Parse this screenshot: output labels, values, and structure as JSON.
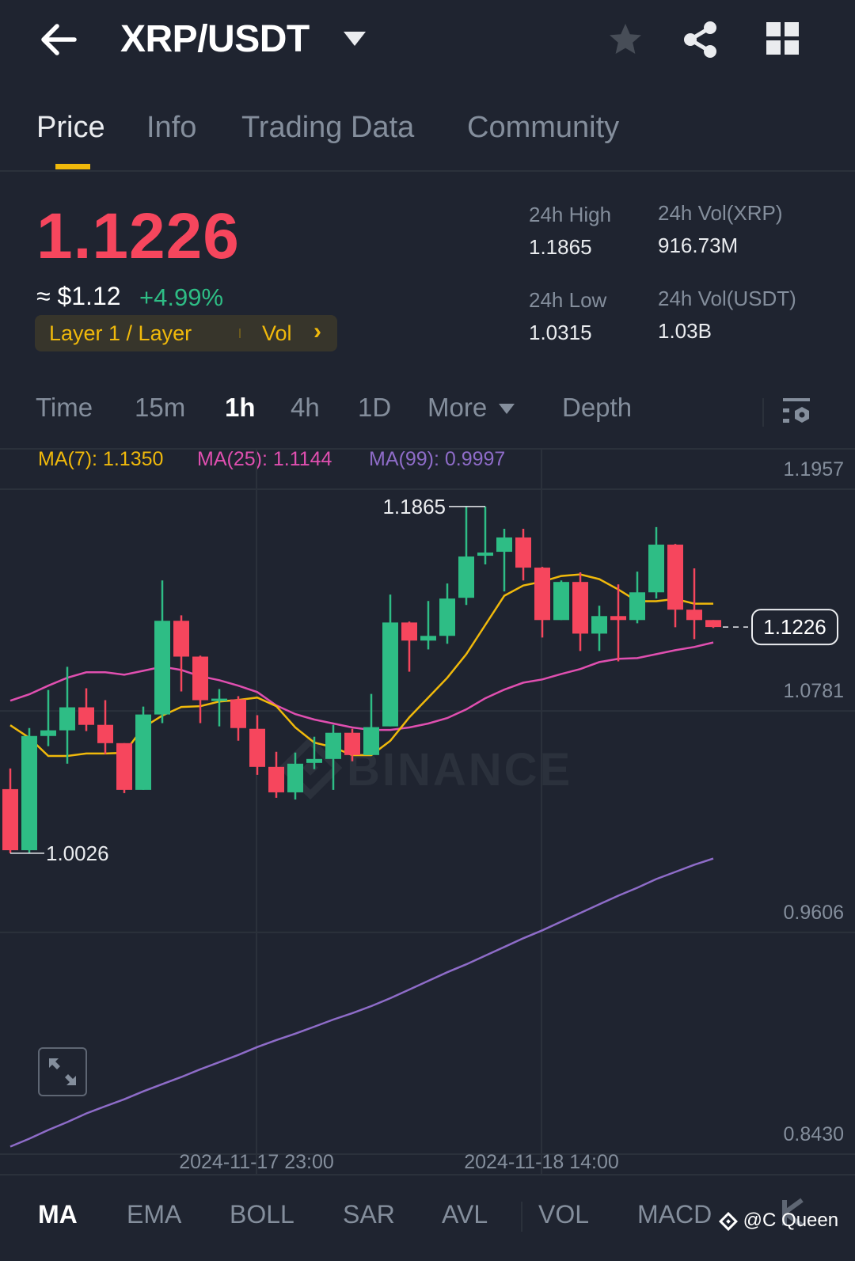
{
  "header": {
    "title": "XRP/USDT",
    "icons": [
      "back-arrow-icon",
      "caret-down-icon",
      "star-icon",
      "share-icon",
      "grid-icon"
    ]
  },
  "tabs": [
    {
      "label": "Price",
      "active": true
    },
    {
      "label": "Info",
      "active": false
    },
    {
      "label": "Trading Data",
      "active": false
    },
    {
      "label": "Community",
      "active": false
    }
  ],
  "ticker": {
    "last_price": "1.1226",
    "fiat_price": "≈ $1.12",
    "change": "+4.99%",
    "tag_label": "Layer 1 / Layer",
    "tag_vol": "Vol",
    "tag_chevron": "›",
    "stats": [
      {
        "label": "24h High",
        "value": "1.1865"
      },
      {
        "label": "24h Vol(XRP)",
        "value": "916.73M"
      },
      {
        "label": "24h Low",
        "value": "1.0315"
      },
      {
        "label": "24h Vol(USDT)",
        "value": "1.03B"
      }
    ]
  },
  "intervals": {
    "items": [
      {
        "label": "Time",
        "active": false
      },
      {
        "label": "15m",
        "active": false
      },
      {
        "label": "1h",
        "active": true
      },
      {
        "label": "4h",
        "active": false
      },
      {
        "label": "1D",
        "active": false
      },
      {
        "label": "More",
        "active": false
      },
      {
        "label": "Depth",
        "active": false
      }
    ]
  },
  "ma_legend": {
    "ma7": "MA(7): 1.1350",
    "ma25": "MA(25): 1.1144",
    "ma99": "MA(99): 0.9997"
  },
  "colors": {
    "up": "#2ebd85",
    "down": "#f6465d",
    "ma7": "#f0b90b",
    "ma25": "#e04fb0",
    "ma99": "#8e6cc8",
    "accent": "#f0b90b"
  },
  "watermark": "BINANCE",
  "indicators": [
    {
      "label": "MA",
      "active": true
    },
    {
      "label": "EMA",
      "active": false
    },
    {
      "label": "BOLL",
      "active": false
    },
    {
      "label": "SAR",
      "active": false
    },
    {
      "label": "AVL",
      "active": false
    },
    {
      "label": "VOL",
      "active": false
    },
    {
      "label": "MACD",
      "active": false
    }
  ],
  "credit": "@C Queen",
  "chart_data": {
    "type": "candlestick",
    "interval": "1h",
    "y_ticks": [
      "1.1957",
      "1.0781",
      "0.9606",
      "0.8430"
    ],
    "ylim": [
      0.843,
      1.1957
    ],
    "x_labels": [
      {
        "index": 13,
        "label": "2024-11-17 23:00"
      },
      {
        "index": 28,
        "label": "2024-11-18 14:00"
      }
    ],
    "high_marker": {
      "index": 25,
      "label": "1.1865"
    },
    "low_marker": {
      "index": 0,
      "label": "1.0026"
    },
    "last_price": {
      "value": 1.1226,
      "label": "1.1226"
    },
    "candles_ohlc": [
      [
        1.0366,
        1.0476,
        1.0026,
        1.0042
      ],
      [
        1.0042,
        1.069,
        1.0026,
        1.0648
      ],
      [
        1.0648,
        1.0892,
        1.0594,
        1.0678
      ],
      [
        1.0678,
        1.1015,
        1.0501,
        1.08
      ],
      [
        1.08,
        1.0901,
        1.0674,
        1.0707
      ],
      [
        1.0707,
        1.0838,
        1.0552,
        1.061
      ],
      [
        1.061,
        1.061,
        1.0345,
        1.0362
      ],
      [
        1.0362,
        1.0804,
        1.0362,
        1.0762
      ],
      [
        1.0762,
        1.1473,
        1.0716,
        1.1259
      ],
      [
        1.1259,
        1.1288,
        1.0884,
        1.1069
      ],
      [
        1.1069,
        1.1074,
        1.0716,
        1.0838
      ],
      [
        1.0834,
        1.0897,
        1.0699,
        1.0846
      ],
      [
        1.0842,
        1.0859,
        1.0623,
        1.069
      ],
      [
        1.0686,
        1.0758,
        1.0442,
        1.0484
      ],
      [
        1.0484,
        1.0564,
        1.032,
        1.0349
      ],
      [
        1.0349,
        1.056,
        1.0311,
        1.0501
      ],
      [
        1.0505,
        1.0644,
        1.0472,
        1.0526
      ],
      [
        1.0526,
        1.0707,
        1.0362,
        1.0665
      ],
      [
        1.0665,
        1.0686,
        1.0514,
        1.0547
      ],
      [
        1.0547,
        1.0871,
        1.0547,
        1.0695
      ],
      [
        1.0699,
        1.1398,
        1.0699,
        1.125
      ],
      [
        1.125,
        1.1255,
        1.0989,
        1.1154
      ],
      [
        1.1154,
        1.1364,
        1.1107,
        1.1179
      ],
      [
        1.1179,
        1.1457,
        1.1137,
        1.1377
      ],
      [
        1.1381,
        1.1865,
        1.1343,
        1.16
      ],
      [
        1.1604,
        1.1865,
        1.1558,
        1.1621
      ],
      [
        1.1625,
        1.1747,
        1.1415,
        1.1701
      ],
      [
        1.1701,
        1.1747,
        1.1473,
        1.1541
      ],
      [
        1.1541,
        1.1545,
        1.117,
        1.1263
      ],
      [
        1.1263,
        1.1473,
        1.1263,
        1.1465
      ],
      [
        1.1465,
        1.1516,
        1.1099,
        1.1191
      ],
      [
        1.1191,
        1.1339,
        1.1099,
        1.1284
      ],
      [
        1.1284,
        1.1452,
        1.1044,
        1.1263
      ],
      [
        1.1263,
        1.152,
        1.1246,
        1.141
      ],
      [
        1.141,
        1.1756,
        1.1377,
        1.1663
      ],
      [
        1.1663,
        1.1667,
        1.1225,
        1.1318
      ],
      [
        1.1318,
        1.1537,
        1.1162,
        1.1263
      ],
      [
        1.1263,
        1.1263,
        1.1221,
        1.1226
      ]
    ],
    "ma7": [
      1.0705,
      1.0638,
      1.0542,
      1.0542,
      1.0555,
      1.0555,
      1.0559,
      1.0693,
      1.0756,
      1.0802,
      1.0806,
      1.0831,
      1.0839,
      1.0852,
      1.0806,
      1.0693,
      1.0613,
      1.0588,
      1.0546,
      1.0546,
      1.0622,
      1.0747,
      1.0852,
      1.0957,
      1.1082,
      1.1237,
      1.1392,
      1.1446,
      1.1467,
      1.1497,
      1.1505,
      1.148,
      1.1425,
      1.1363,
      1.1363,
      1.1375,
      1.135,
      1.135
    ],
    "ma25": [
      1.0835,
      1.0869,
      1.0915,
      1.0957,
      1.0986,
      1.0986,
      1.0973,
      1.0994,
      1.1015,
      1.0998,
      1.0965,
      1.0944,
      1.0915,
      1.0881,
      1.081,
      1.0764,
      1.0735,
      1.0714,
      1.0693,
      1.068,
      1.068,
      1.0693,
      1.0714,
      1.0743,
      1.0789,
      1.0848,
      1.0894,
      1.0931,
      1.0948,
      1.0977,
      1.1003,
      1.104,
      1.1057,
      1.1061,
      1.1082,
      1.1103,
      1.112,
      1.1144
    ],
    "ma99": [
      0.847,
      0.8512,
      0.8558,
      0.86,
      0.8646,
      0.8684,
      0.8721,
      0.8763,
      0.8801,
      0.8839,
      0.888,
      0.8918,
      0.8956,
      0.8998,
      0.9035,
      0.9069,
      0.9106,
      0.9144,
      0.9178,
      0.9215,
      0.9257,
      0.9303,
      0.9349,
      0.9395,
      0.9437,
      0.9483,
      0.9529,
      0.9575,
      0.9617,
      0.9663,
      0.9709,
      0.9755,
      0.9801,
      0.9843,
      0.9889,
      0.9927,
      0.9965,
      0.9998
    ]
  }
}
